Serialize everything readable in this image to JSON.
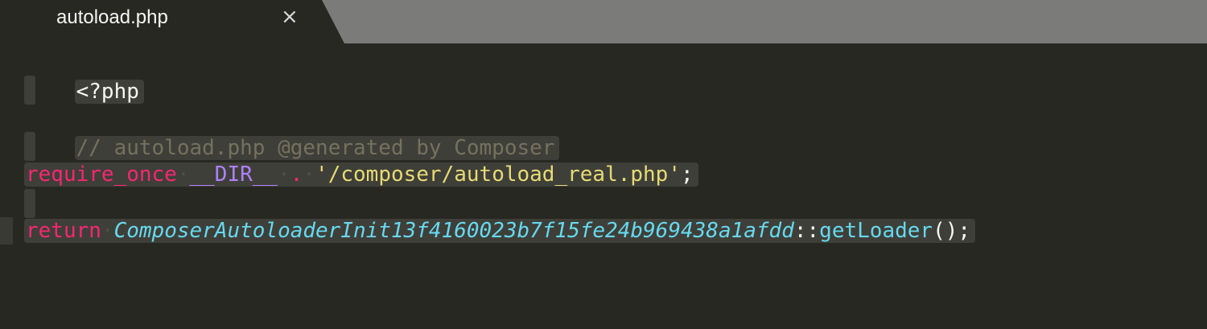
{
  "tab": {
    "filename": "autoload.php",
    "close_glyph": "×"
  },
  "code": {
    "line1": {
      "text": "<?php"
    },
    "line3": {
      "text": "// autoload.php @generated by Composer"
    },
    "line5": {
      "keyword": "require_once",
      "constant": "__DIR__",
      "operator": ".",
      "string": "'/composer/autoload_real.php'",
      "end": ";"
    },
    "line7": {
      "keyword": "return",
      "class": "ComposerAutoloaderInit13f4160023b7f15fe24b969438a1afdd",
      "scope": "::",
      "method": "getLoader",
      "end": "();"
    }
  },
  "theme": {
    "background": "#272822",
    "keyword": "#f92672",
    "constant": "#ae81ff",
    "string": "#e6db74",
    "class": "#66d9ef",
    "comment": "#75715e"
  },
  "icons": {
    "close": "close-icon"
  }
}
